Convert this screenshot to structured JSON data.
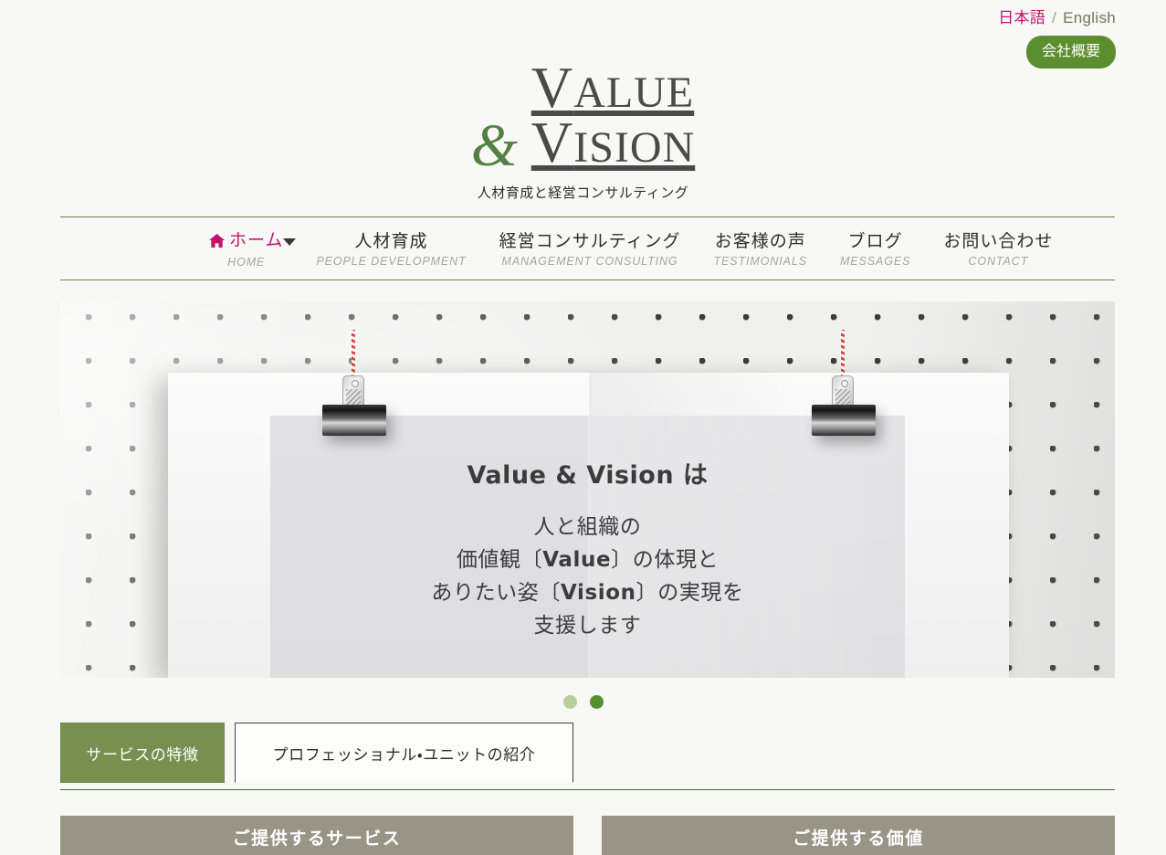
{
  "topbar": {
    "lang_ja": "日本語",
    "lang_sep": "/",
    "lang_en": "English",
    "company_button": "会社概要"
  },
  "logo": {
    "line1_cap": "V",
    "line1_rest": "ALUE",
    "amp": "&",
    "line2_cap": "V",
    "line2_rest": "ISION",
    "tagline": "人材育成と経営コンサルティング"
  },
  "nav": {
    "items": [
      {
        "ja": "ホーム",
        "en": "HOME",
        "icon": "home-icon",
        "active": true,
        "caret": false
      },
      {
        "ja": "人材育成",
        "en": "PEOPLE DEVELOPMENT",
        "icon": "",
        "active": false,
        "caret": true
      },
      {
        "ja": "経営コンサルティング",
        "en": "MANAGEMENT CONSULTING",
        "icon": "",
        "active": false,
        "caret": false
      },
      {
        "ja": "お客様の声",
        "en": "TESTIMONIALS",
        "icon": "",
        "active": false,
        "caret": false
      },
      {
        "ja": "ブログ",
        "en": "MESSAGES",
        "icon": "",
        "active": false,
        "caret": false
      },
      {
        "ja": "お問い合わせ",
        "en": "CONTACT",
        "icon": "",
        "active": false,
        "caret": false
      }
    ]
  },
  "hero": {
    "heading": "Value & Vision は",
    "line1": "人と組織の",
    "line2_a": "価値観〔",
    "line2_b": "Value",
    "line2_c": "〕の体現と",
    "line3_a": "ありたい姿〔",
    "line3_b": "Vision",
    "line3_c": "〕の実現を",
    "line4": "支援します"
  },
  "carousel": {
    "dots": [
      {
        "label": "slide-1",
        "active": false
      },
      {
        "label": "slide-2",
        "active": true
      }
    ]
  },
  "tabs": [
    {
      "label": "サービスの特徴",
      "active": true
    },
    {
      "label": "プロフェッショナル・ユニットの紹介",
      "active": false
    }
  ],
  "columns": [
    {
      "title": "ご提供するサービス"
    },
    {
      "title": "ご提供する価値"
    }
  ],
  "colors": {
    "accent_green": "#5b8e2e",
    "nav_pink": "#c5136b",
    "tab_green": "#77904f",
    "col_head_gray": "#999486",
    "logo_amp_green": "#538045"
  }
}
